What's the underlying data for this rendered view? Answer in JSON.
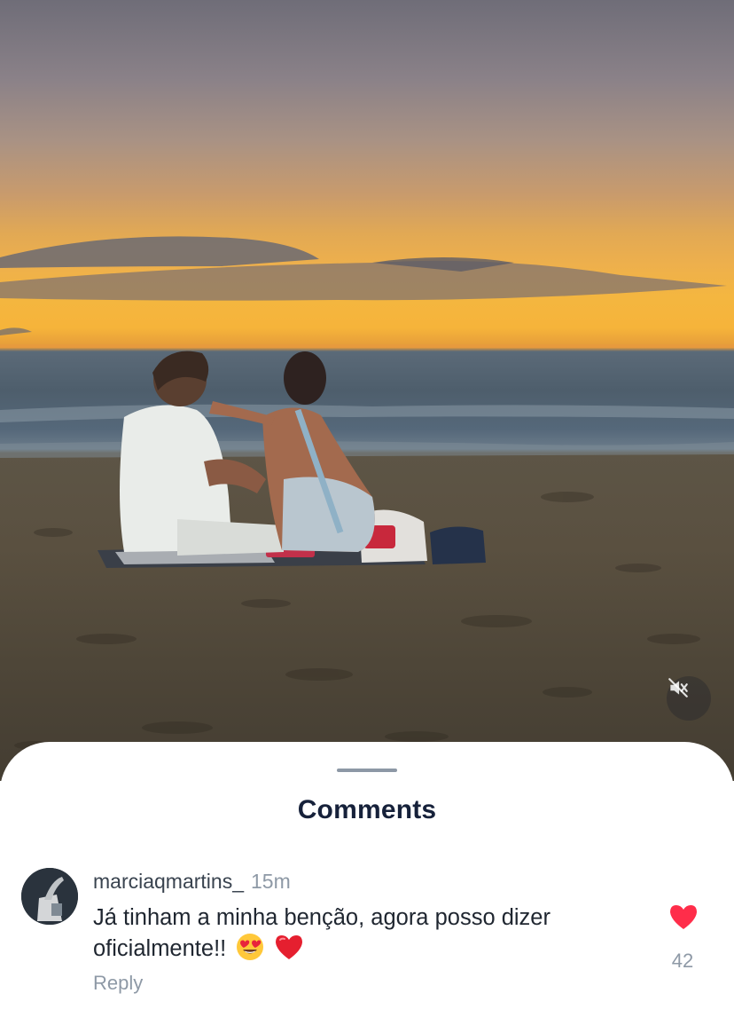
{
  "video": {
    "mute_icon": "speaker-muted-icon"
  },
  "comments_sheet": {
    "title": "Comments",
    "comments": [
      {
        "avatar_icon": "avatar-photo",
        "username": "marciaqmartins_",
        "time_ago": "15m",
        "text": "Já tinham a minha benção, agora posso dizer oficialmente!!",
        "emojis": [
          "heart-eyes-emoji",
          "red-heart-emoji"
        ],
        "reply_label": "Reply",
        "like_icon": "heart-icon",
        "like_color": "#ff2d4a",
        "like_count": "42"
      }
    ]
  }
}
